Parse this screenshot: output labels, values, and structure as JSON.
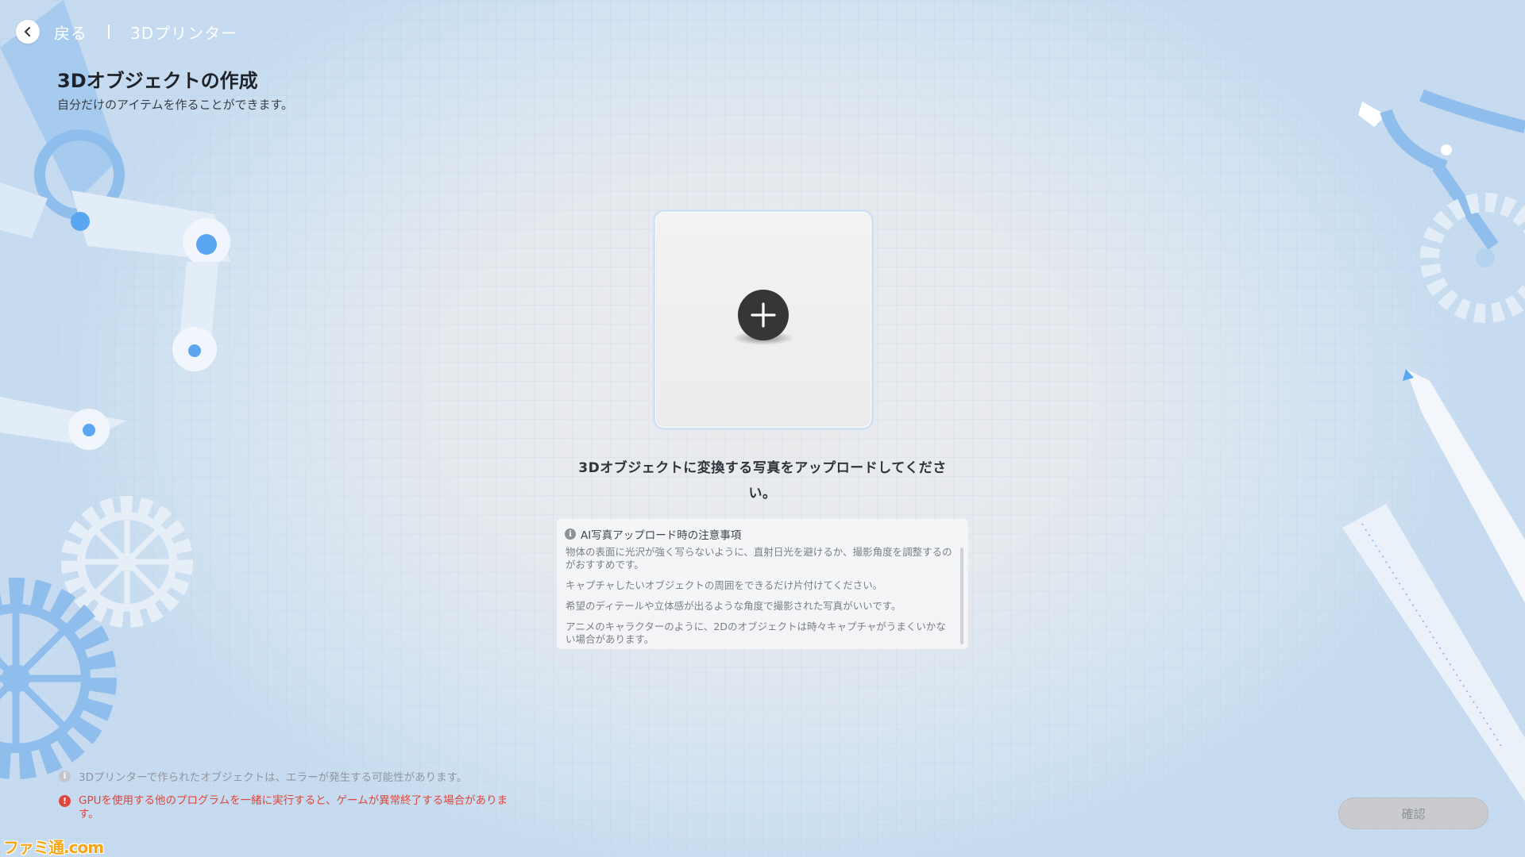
{
  "header": {
    "back_label": "戻る",
    "breadcrumb": "3Dプリンター"
  },
  "page": {
    "title": "3Dオブジェクトの作成",
    "subtitle": "自分だけのアイテムを作ることができます。"
  },
  "upload": {
    "instruction": "3Dオブジェクトに変換する写真をアップロードしてください。"
  },
  "notes": {
    "title": "AI写真アップロード時の注意事項",
    "items": [
      "物体の表面に光沢が強く写らないように、直射日光を避けるか、撮影角度を調整するのがおすすめです。",
      "キャプチャしたいオブジェクトの周囲をできるだけ片付けてください。",
      "希望のディテールや立体感が出るような角度で撮影された写真がいいです。",
      "アニメのキャラクターのように、2Dのオブジェクトは時々キャプチャがうまくいかない場合があります。"
    ]
  },
  "footer": {
    "notice_info": "3Dプリンターで作られたオブジェクトは、エラーが発生する可能性があります。",
    "notice_warning": "GPUを使用する他のプログラムを一緒に実行すると、ゲームが異常終了する場合があります。",
    "confirm_label": "確認"
  },
  "watermark": "ファミ通.com",
  "colors": {
    "accent_blue": "#8fbdec",
    "warning_red": "#e0453b",
    "button_disabled": "#c9cbcf",
    "plus_button": "#363636"
  },
  "icons": {
    "back": "chevron-left-icon",
    "upload": "plus-circle-icon",
    "notes": "info-icon",
    "notice_info": "info-icon",
    "notice_warning": "alert-icon"
  }
}
